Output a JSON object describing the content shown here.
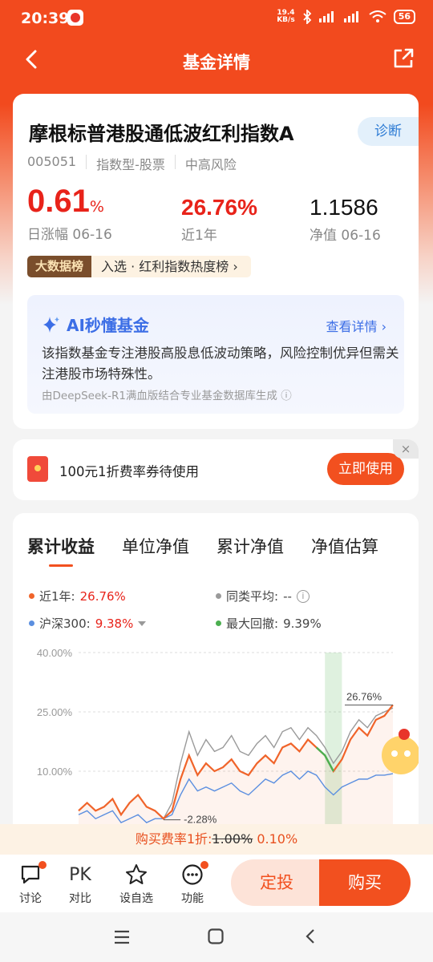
{
  "status_bar": {
    "time": "20:39",
    "net_speed_value": "19.4",
    "net_speed_unit": "KB/s",
    "signal_label_1": "HD",
    "signal_label_2": "HD",
    "battery": "56"
  },
  "header": {
    "title": "基金详情",
    "back_icon": "chevron-left-icon",
    "share_icon": "share-icon"
  },
  "fund": {
    "name": "摩根标普港股通低波红利指数A",
    "diagnose_label": "诊断",
    "code": "005051",
    "type": "指数型-股票",
    "risk": "中高风险",
    "daily_change_value": "0.61",
    "daily_change_unit": "%",
    "daily_change_label": "日涨幅 06-16",
    "year_return": "26.76%",
    "year_return_label": "近1年",
    "nav": "1.1586",
    "nav_label": "净值 06-16",
    "rank_tag": "大数据榜",
    "rank_text": "入选 · 红利指数热度榜"
  },
  "ai": {
    "title": "AI秒懂基金",
    "link": "查看详情",
    "summary": "该指数基金专注港股高股息低波动策略，风险控制优异但需关注港股市场特殊性。",
    "source": "由DeepSeek-R1满血版结合专业基金数据库生成"
  },
  "coupon": {
    "text": "100元1折费率券待使用",
    "button": "立即使用",
    "close": "×"
  },
  "chart_tabs": [
    "累计收益",
    "单位净值",
    "累计净值",
    "净值估算"
  ],
  "legend": {
    "fund_label": "近1年:",
    "fund_value": "26.76%",
    "peer_label": "同类平均:",
    "peer_value": "--",
    "index_label": "沪深300:",
    "index_value": "9.38%",
    "drawdown_label": "最大回撤:",
    "drawdown_value": "9.39%"
  },
  "colors": {
    "brand": "#f2501f",
    "fund_line": "#f0642a",
    "index_line": "#5b8fe0",
    "peer_line": "#9a9a9a",
    "drawdown": "#4caf50",
    "up": "#e8231a"
  },
  "chart_data": {
    "type": "line",
    "y_ticks": [
      "40.00%",
      "25.00%",
      "10.00%"
    ],
    "ylim": [
      -5,
      40
    ],
    "annotations": [
      "26.76%",
      "-2.28%"
    ],
    "series": [
      {
        "name": "近1年",
        "values": [
          0,
          2,
          0,
          1,
          3,
          -1,
          2,
          4,
          1,
          0,
          -2,
          0,
          8,
          14,
          9,
          12,
          10,
          11,
          13,
          10,
          9,
          12,
          14,
          12,
          16,
          17,
          15,
          18,
          16,
          14,
          10,
          13,
          18,
          21,
          19,
          23,
          24,
          26.76
        ]
      },
      {
        "name": "沪深300",
        "values": [
          -1,
          0,
          -2,
          -1,
          0,
          -3,
          -2,
          -1,
          -3,
          -2,
          -2,
          -1,
          4,
          8,
          5,
          6,
          5,
          6,
          7,
          5,
          4,
          6,
          8,
          7,
          9,
          10,
          8,
          10,
          9,
          6,
          4,
          6,
          7,
          8,
          8,
          9,
          9,
          9.38
        ]
      },
      {
        "name": "同类平均",
        "values": [
          null,
          null,
          null,
          null,
          null,
          null,
          null,
          null,
          null,
          null,
          -2,
          2,
          12,
          20,
          14,
          18,
          15,
          16,
          19,
          15,
          14,
          17,
          19,
          16,
          20,
          21,
          18,
          21,
          19,
          16,
          12,
          15,
          20,
          23,
          21,
          24,
          25,
          26
        ]
      }
    ]
  },
  "fee": {
    "prefix": "购买费率1折:",
    "original": "1.00%",
    "discounted": "0.10%"
  },
  "bottom_bar": {
    "items": [
      "讨论",
      "对比",
      "设自选",
      "功能"
    ],
    "pk_text": "PK",
    "dingtou": "定投",
    "buy": "购买"
  }
}
